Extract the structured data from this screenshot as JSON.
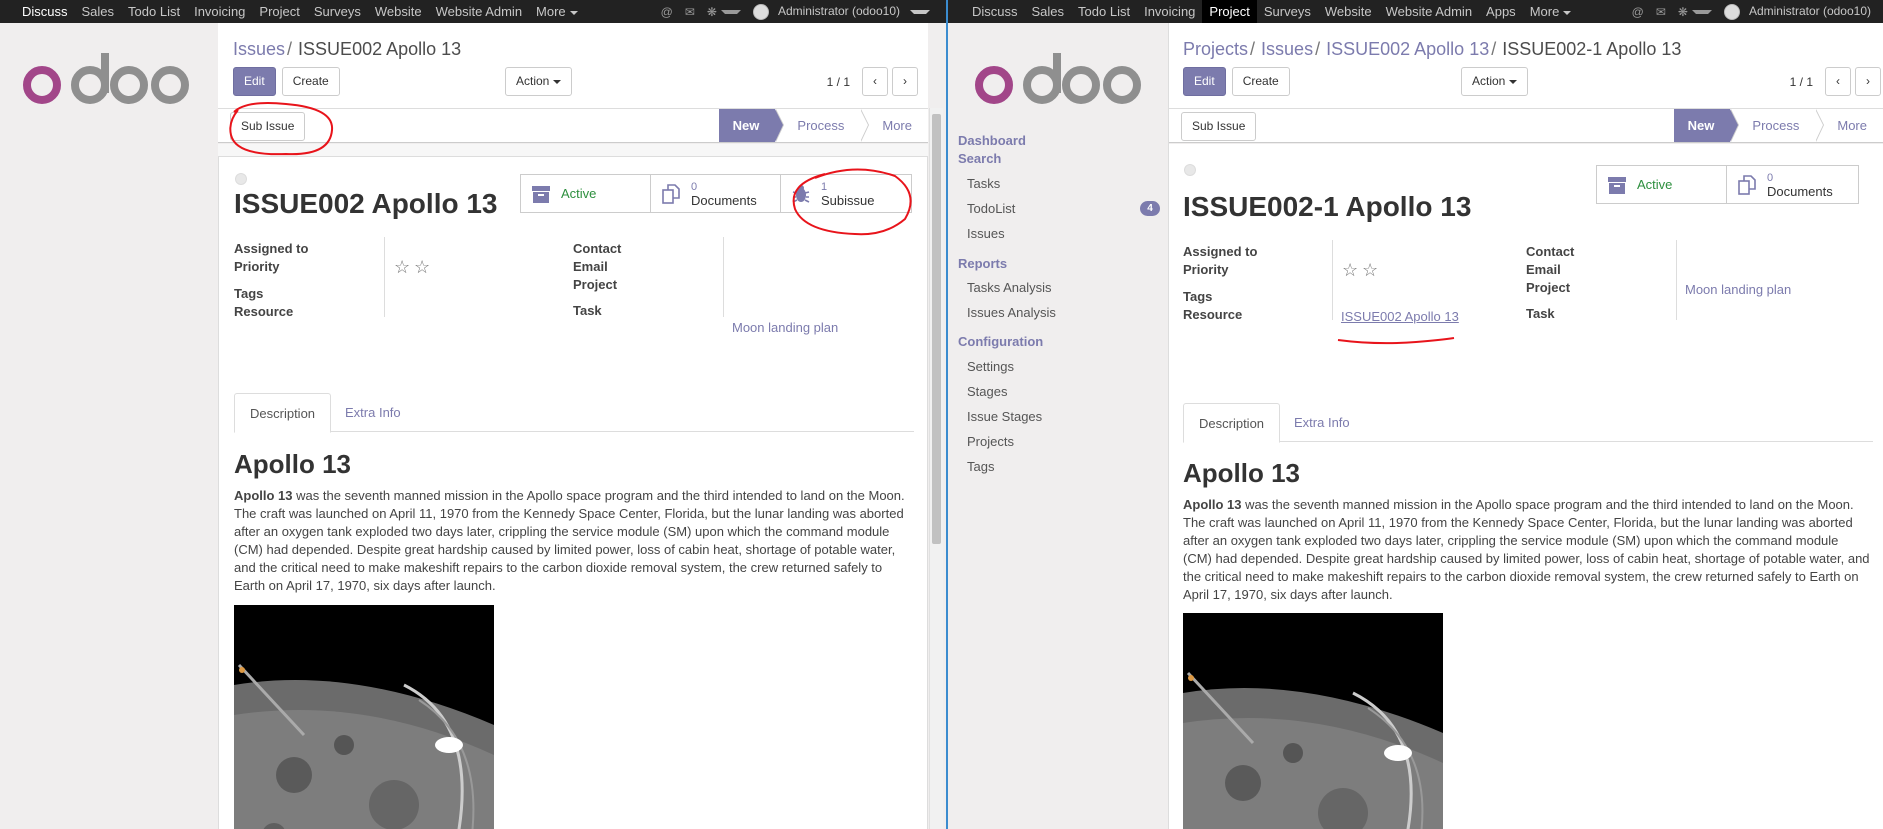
{
  "left": {
    "topbar": {
      "items": [
        "Discuss",
        "Sales",
        "Todo List",
        "Invoicing",
        "Project",
        "Surveys",
        "Website",
        "Website Admin",
        "More"
      ],
      "user": "Administrator (odoo10)"
    },
    "breadcrumb": {
      "parent": "Issues",
      "current": "ISSUE002 Apollo 13"
    },
    "buttons": {
      "edit": "Edit",
      "create": "Create",
      "action": "Action",
      "sub_issue": "Sub Issue"
    },
    "pager": "1 / 1",
    "stages": [
      "New",
      "Process",
      "More"
    ],
    "stat_buttons": {
      "active": "Active",
      "documents_count": "0",
      "documents_label": "Documents",
      "subissue_count": "1",
      "subissue_label": "Subissue"
    },
    "title": "ISSUE002 Apollo 13",
    "fields": {
      "assigned_to": "Assigned to",
      "priority": "Priority",
      "tags": "Tags",
      "resource": "Resource",
      "contact": "Contact",
      "email": "Email",
      "project": "Project",
      "task": "Task",
      "project_value": "Moon landing plan"
    },
    "tabs": [
      "Description",
      "Extra Info"
    ],
    "desc_heading": "Apollo 13",
    "desc_bold": "Apollo 13",
    "desc_lines": [
      " was the seventh manned mission in the Apollo space program and the third intended to land on the Moon.",
      "The craft was launched on April 11, 1970 from the Kennedy Space Center, Florida, but the lunar landing was aborted",
      "after an oxygen tank exploded two days later, crippling the service module (SM) upon which the command module",
      "(CM) had depended. Despite great hardship caused by limited power, loss of cabin heat, shortage of potable water,",
      "and the critical need to make makeshift repairs to the carbon dioxide removal system, the crew returned safely to",
      "Earth on April 17, 1970, six days after launch."
    ]
  },
  "right": {
    "topbar": {
      "items": [
        "Discuss",
        "Sales",
        "Todo List",
        "Invoicing",
        "Project",
        "Surveys",
        "Website",
        "Website Admin",
        "Apps",
        "More"
      ],
      "active": "Project",
      "user": "Administrator (odoo10)"
    },
    "sidebar": {
      "dashboard": "Dashboard",
      "search": "Search",
      "search_items": [
        "Tasks",
        "TodoList",
        "Issues"
      ],
      "todolist_badge": "4",
      "reports": "Reports",
      "report_items": [
        "Tasks Analysis",
        "Issues Analysis"
      ],
      "configuration": "Configuration",
      "config_items": [
        "Settings",
        "Stages",
        "Issue Stages",
        "Projects",
        "Tags"
      ]
    },
    "breadcrumb": {
      "b1": "Projects",
      "b2": "Issues",
      "b3": "ISSUE002 Apollo 13",
      "current": "ISSUE002-1 Apollo 13"
    },
    "buttons": {
      "edit": "Edit",
      "create": "Create",
      "action": "Action",
      "sub_issue": "Sub Issue"
    },
    "pager": "1 / 1",
    "stages": [
      "New",
      "Process",
      "More"
    ],
    "stat_buttons": {
      "active": "Active",
      "documents_count": "0",
      "documents_label": "Documents"
    },
    "title": "ISSUE002-1 Apollo 13",
    "fields": {
      "assigned_to": "Assigned to",
      "priority": "Priority",
      "tags": "Tags",
      "resource": "Resource",
      "contact": "Contact",
      "email": "Email",
      "project": "Project",
      "task": "Task",
      "project_value": "Moon landing plan",
      "resource_value": "ISSUE002 Apollo 13"
    },
    "tabs": [
      "Description",
      "Extra Info"
    ],
    "desc_heading": "Apollo 13",
    "desc_bold": "Apollo 13",
    "desc_lines": [
      " was the seventh manned mission in the Apollo space program and the third intended to land on the Moon.",
      "The craft was launched on April 11, 1970 from the Kennedy Space Center, Florida, but the lunar landing was aborted",
      "after an oxygen tank exploded two days later, crippling the service module (SM) upon which the command module",
      "(CM) had depended. Despite great hardship caused by limited power, loss of cabin heat, shortage of potable water, and",
      "the critical need to make makeshift repairs to the carbon dioxide removal system, the crew returned safely to Earth on",
      "April 17, 1970, six days after launch."
    ]
  },
  "colors": {
    "brand": "#7c7bad",
    "topbar": "#222222",
    "active_green": "#2d8f3e",
    "annotation": "#e8141b"
  }
}
